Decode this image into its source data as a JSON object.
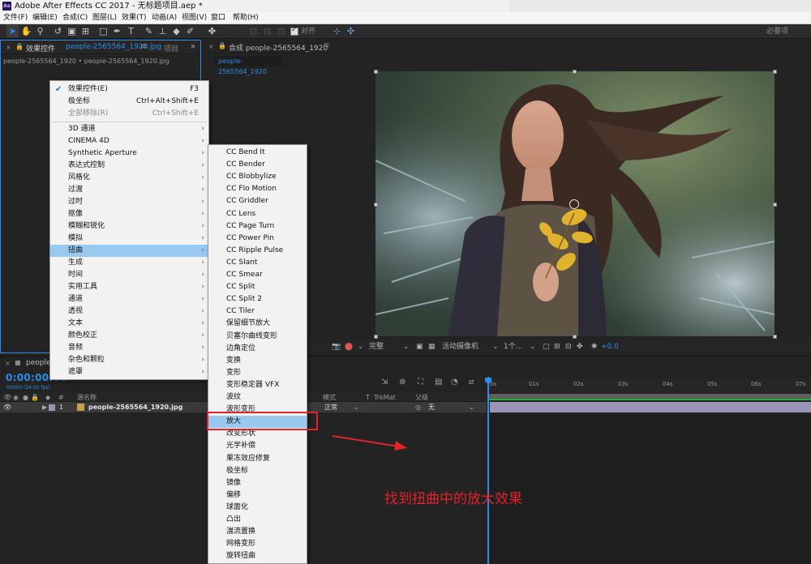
{
  "app": {
    "title": "Adobe After Effects CC 2017 - 无标题项目.aep *",
    "logo_text": "Ae"
  },
  "menubar": [
    "文件(F)",
    "编辑(E)",
    "合成(C)",
    "图层(L)",
    "效果(T)",
    "动画(A)",
    "视图(V)",
    "窗口",
    "帮助(H)"
  ],
  "toolbar": {
    "snap_label": "对齐",
    "workspace_label": "必要项"
  },
  "effects_panel": {
    "tab_prefix": "效果控件",
    "tab_file": "people-2565564_1920.jpg",
    "tab_project": "项目",
    "subtitle": "people-2565564_1920 • people-2565564_1920.jpg"
  },
  "comp_panel": {
    "tab_label": "合成 people-2565564_1920",
    "active_tab": "people-2565564_1920"
  },
  "viewer_controls": {
    "resolution": "完整",
    "camera": "活动摄像机",
    "views": "1个...",
    "exposure": "+0.0"
  },
  "timeline": {
    "tab_label": "people-2565564_1920",
    "timecode": "0:00:00:00",
    "fps_info": "00000 (24.00 fps)",
    "columns": {
      "source_name": "源名称",
      "mode": "模式",
      "trkmat": "TrkMat",
      "parent": "父级"
    },
    "layer": {
      "index": "1",
      "name": "people-2565564_1920.jpg",
      "mode": "正常",
      "parent": "无"
    },
    "ruler_ticks": [
      "0s",
      "01s",
      "02s",
      "03s",
      "04s",
      "05s",
      "06s",
      "07s"
    ]
  },
  "context_menu": {
    "items": [
      {
        "label": "效果控件(E)",
        "shortcut": "F3",
        "checked": true
      },
      {
        "label": "极坐标",
        "shortcut": "Ctrl+Alt+Shift+E"
      },
      {
        "label": "全部移除(R)",
        "shortcut": "Ctrl+Shift+E",
        "disabled": true
      },
      {
        "label": "3D 通道",
        "submenu": true
      },
      {
        "label": "CINEMA 4D",
        "submenu": true
      },
      {
        "label": "Synthetic Aperture",
        "submenu": true
      },
      {
        "label": "表达式控制",
        "submenu": true
      },
      {
        "label": "风格化",
        "submenu": true
      },
      {
        "label": "过渡",
        "submenu": true
      },
      {
        "label": "过时",
        "submenu": true
      },
      {
        "label": "抠像",
        "submenu": true
      },
      {
        "label": "模糊和锐化",
        "submenu": true
      },
      {
        "label": "模拟",
        "submenu": true
      },
      {
        "label": "扭曲",
        "submenu": true,
        "highlighted": true
      },
      {
        "label": "生成",
        "submenu": true
      },
      {
        "label": "时间",
        "submenu": true
      },
      {
        "label": "实用工具",
        "submenu": true
      },
      {
        "label": "通道",
        "submenu": true
      },
      {
        "label": "透视",
        "submenu": true
      },
      {
        "label": "文本",
        "submenu": true
      },
      {
        "label": "颜色校正",
        "submenu": true
      },
      {
        "label": "音频",
        "submenu": true
      },
      {
        "label": "杂色和颗粒",
        "submenu": true
      },
      {
        "label": "遮罩",
        "submenu": true
      }
    ]
  },
  "distort_submenu": {
    "items": [
      "CC Bend It",
      "CC Bender",
      "CC Blobbylize",
      "CC Flo Motion",
      "CC Griddler",
      "CC Lens",
      "CC Page Turn",
      "CC Power Pin",
      "CC Ripple Pulse",
      "CC Slant",
      "CC Smear",
      "CC Split",
      "CC Split 2",
      "CC Tiler",
      "保留细节放大",
      "贝塞尔曲线变形",
      "边角定位",
      "变换",
      "变形",
      "变形稳定器 VFX",
      "波纹",
      "波形变形",
      "放大",
      "改变形状",
      "光学补偿",
      "果冻效应修复",
      "极坐标",
      "镜像",
      "偏移",
      "球面化",
      "凸出",
      "湍流置换",
      "网格变形",
      "旋转扭曲"
    ],
    "highlighted": "放大"
  },
  "annotation": "找到扭曲中的放大效果",
  "colors": {
    "accent": "#2d8ceb",
    "annotation_red": "#e2232a",
    "menu_highlight": "#99c9ef"
  }
}
